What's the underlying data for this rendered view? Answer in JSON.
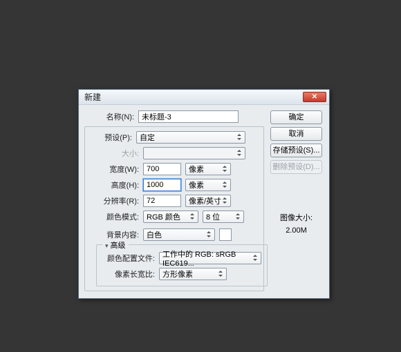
{
  "dialog": {
    "title": "新建"
  },
  "name": {
    "label": "名称(N):",
    "value": "未标题-3"
  },
  "preset": {
    "label": "预设(P):",
    "value": "自定"
  },
  "size": {
    "label": "大小:",
    "value": ""
  },
  "width": {
    "label": "宽度(W):",
    "value": "700",
    "unit": "像素"
  },
  "height": {
    "label": "高度(H):",
    "value": "1000",
    "unit": "像素"
  },
  "resolution": {
    "label": "分辨率(R):",
    "value": "72",
    "unit": "像素/英寸"
  },
  "colorMode": {
    "label": "颜色模式:",
    "mode": "RGB 颜色",
    "depth": "8 位"
  },
  "bgContents": {
    "label": "背景内容:",
    "value": "白色"
  },
  "advanced": {
    "legend": "高级"
  },
  "colorProfile": {
    "label": "颜色配置文件:",
    "value": "工作中的 RGB: sRGB IEC619..."
  },
  "pixelAspect": {
    "label": "像素长宽比:",
    "value": "方形像素"
  },
  "buttons": {
    "ok": "确定",
    "cancel": "取消",
    "savePreset": "存储预设(S)...",
    "deletePreset": "删除预设(D)..."
  },
  "imageSize": {
    "label": "图像大小:",
    "value": "2.00M"
  }
}
